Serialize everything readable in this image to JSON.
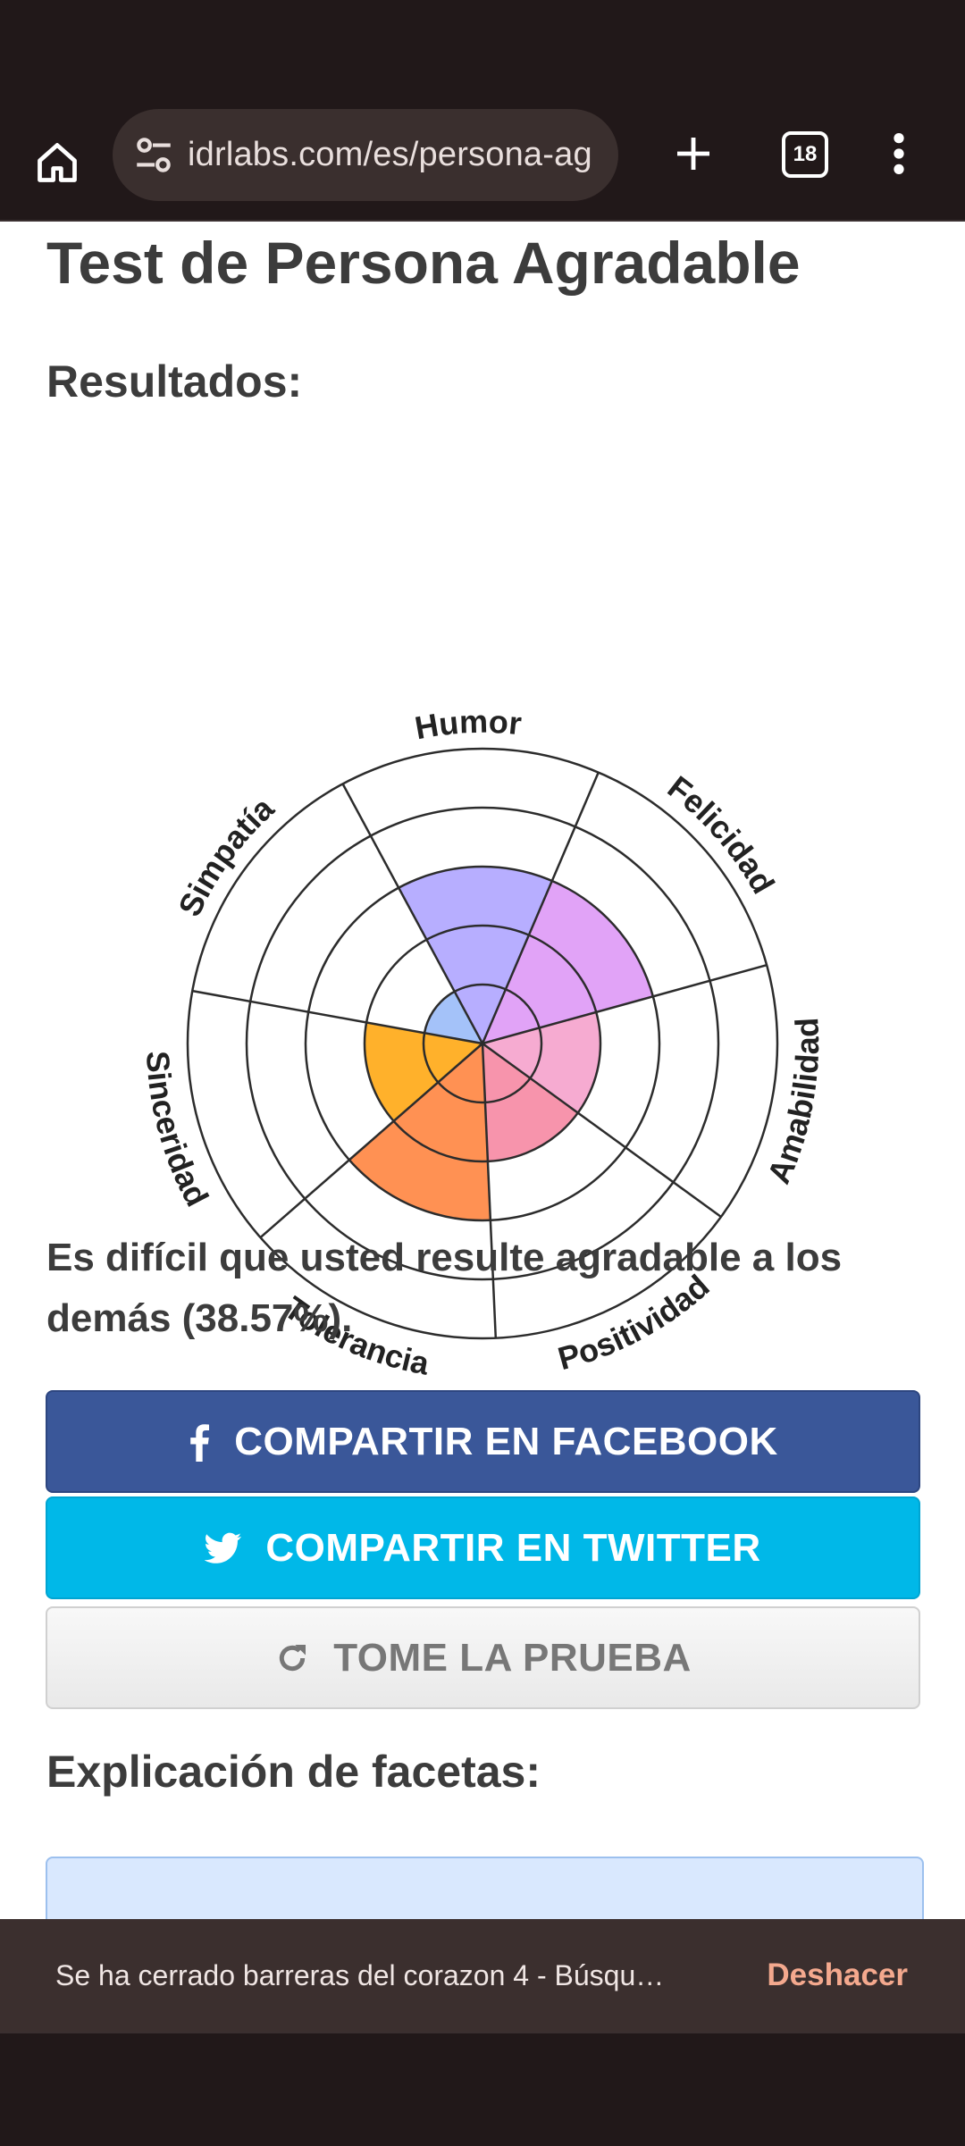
{
  "browser": {
    "url": "idrlabs.com/es/persona-ag",
    "tab_count": "18",
    "icons": {
      "home": "home-icon",
      "site_settings": "tune-icon",
      "new_tab": "plus-icon",
      "tabs": "tab-switcher-icon",
      "menu": "more-vert-icon"
    },
    "colors": {
      "chrome": "#211819",
      "urlbar": "#3a2f2e"
    }
  },
  "page": {
    "title": "Test de Persona Agradable",
    "results_heading": "Resultados:",
    "result_text": "Es difícil que usted resulte agradable a los demás (38.57%).",
    "facets_heading": "Explicación de facetas:"
  },
  "buttons": {
    "facebook": {
      "label": "COMPARTIR EN FACEBOOK",
      "icon": "facebook-icon",
      "color": "#3a5799"
    },
    "twitter": {
      "label": "COMPARTIR EN TWITTER",
      "icon": "twitter-icon",
      "color": "#00b8e8"
    },
    "retake": {
      "label": "TOME LA PRUEBA",
      "icon": "refresh-icon"
    }
  },
  "snackbar": {
    "message": "Se ha cerrado barreras del corazon 4 - Búsqu…",
    "action": "Deshacer"
  },
  "chart_data": {
    "type": "radar",
    "categories": [
      "Humor",
      "Felicidad",
      "Amabilidad",
      "Positividad",
      "Tolerancia",
      "Sinceridad",
      "Simpatía"
    ],
    "values": [
      3,
      3,
      2,
      2,
      3,
      2,
      1
    ],
    "rlim": [
      0,
      5
    ],
    "rings": 5,
    "colors": [
      "#b3aaff",
      "#df9ef7",
      "#f5a7cf",
      "#f78ea8",
      "#ff8b4a",
      "#ffad20",
      "#9fbff9"
    ],
    "grid": true
  }
}
